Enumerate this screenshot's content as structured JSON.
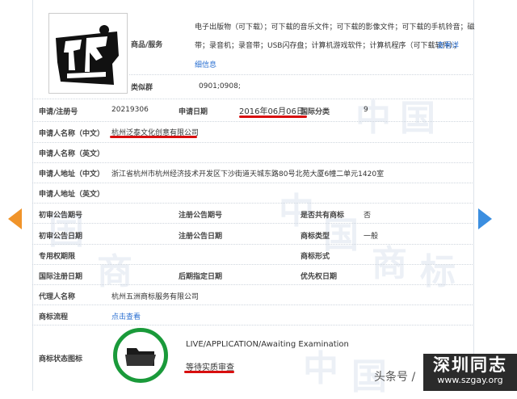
{
  "goods": {
    "label": "商品/服务",
    "line1": "电子出版物（可下载）；可下载的音乐文件；可下载的影像文件；可下载的手机铃音；磁",
    "line2": "带；录音机；录音带；USB闪存盘；计算机游戏软件；计算机程序（可下载软件）；",
    "more_link": "查看详",
    "more_link2": "细信息"
  },
  "similar_group": {
    "label": "类似群",
    "value": "0901;0908;"
  },
  "app_no": {
    "label": "申请/注册号",
    "value": "20219306"
  },
  "app_date": {
    "label": "申请日期",
    "value": "2016年06月06日"
  },
  "intl_class": {
    "label": "国际分类",
    "value": "9"
  },
  "applicant_cn": {
    "label": "申请人名称（中文）",
    "value": "杭州泛泰文化创意有限公司"
  },
  "applicant_en": {
    "label": "申请人名称（英文）",
    "value": ""
  },
  "address_cn": {
    "label": "申请人地址（中文）",
    "value": "浙江省杭州市杭州经济技术开发区下沙街道天城东路80号北苑大厦6幢二单元1420室"
  },
  "address_en": {
    "label": "申请人地址（英文）",
    "value": ""
  },
  "prelim_issue": {
    "label": "初审公告期号",
    "value": ""
  },
  "reg_issue": {
    "label": "注册公告期号",
    "value": ""
  },
  "shared": {
    "label": "是否共有商标",
    "value": "否"
  },
  "prelim_date": {
    "label": "初审公告日期",
    "value": ""
  },
  "reg_date": {
    "label": "注册公告日期",
    "value": ""
  },
  "tm_type": {
    "label": "商标类型",
    "value": "一般"
  },
  "exclusive": {
    "label": "专用权期限",
    "value": ""
  },
  "tm_form": {
    "label": "商标形式",
    "value": ""
  },
  "intl_reg_date": {
    "label": "国际注册日期",
    "value": ""
  },
  "later_date": {
    "label": "后期指定日期",
    "value": ""
  },
  "priority_date": {
    "label": "优先权日期",
    "value": ""
  },
  "agent": {
    "label": "代理人名称",
    "value": "杭州五洲商标服务有限公司"
  },
  "process": {
    "label": "商标流程",
    "link": "点击查看"
  },
  "status": {
    "label": "商标状态图标",
    "en": "LIVE/APPLICATION/Awaiting Examination",
    "cn": "等待实质审查"
  },
  "watermark": [
    "中",
    "国",
    "商",
    "标"
  ],
  "footer": {
    "text": "头条号 /"
  },
  "brand": {
    "cn": "深圳同志",
    "url": "www.szgay.org"
  },
  "colors": {
    "link": "#2a6fd1",
    "underline": "#d80e0e",
    "status_ring": "#1a9a3a",
    "arrow_left": "#f0942a",
    "arrow_right": "#3b8ee0"
  }
}
